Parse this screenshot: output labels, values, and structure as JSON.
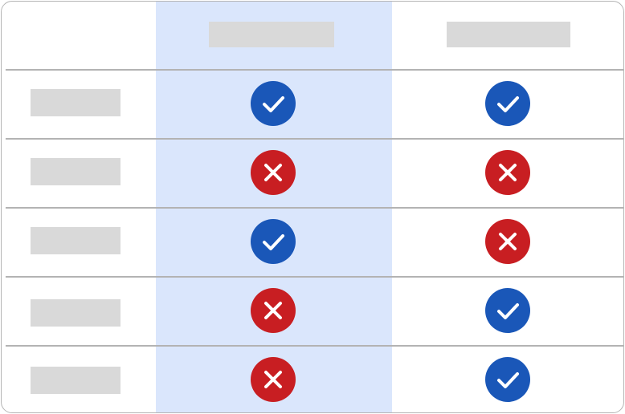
{
  "comparison": {
    "columns": [
      {
        "header": "",
        "highlighted": true
      },
      {
        "header": "",
        "highlighted": false
      }
    ],
    "rows": [
      {
        "label": "",
        "values": [
          "check",
          "check"
        ]
      },
      {
        "label": "",
        "values": [
          "cross",
          "cross"
        ]
      },
      {
        "label": "",
        "values": [
          "check",
          "cross"
        ]
      },
      {
        "label": "",
        "values": [
          "cross",
          "check"
        ]
      },
      {
        "label": "",
        "values": [
          "cross",
          "check"
        ]
      }
    ]
  },
  "icons": {
    "check": "check-circle-icon",
    "cross": "x-circle-icon"
  },
  "colors": {
    "check": "#1a57b8",
    "cross": "#c81e22",
    "highlight_column": "#dae6fc",
    "placeholder": "#d9d9d9",
    "divider": "#b3b3b3"
  }
}
